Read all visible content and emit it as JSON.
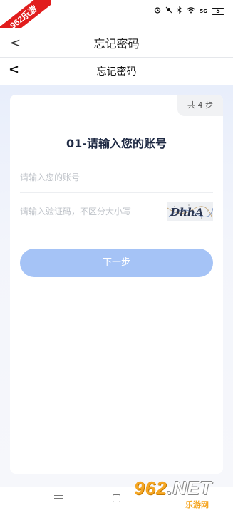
{
  "status_bar": {
    "signal_label": "5G",
    "battery_label": "5"
  },
  "watermark": {
    "ribbon": "962乐游",
    "logo_number": "962",
    "logo_suffix": ".NET",
    "logo_sub": "乐游网"
  },
  "outer_header": {
    "back_glyph": "<",
    "title": "忘记密码"
  },
  "inner_header": {
    "back_glyph": "<",
    "title": "忘记密码"
  },
  "card": {
    "step_badge": "共 4 步",
    "step_title": "01-请输入您的账号",
    "account_field": {
      "value": "",
      "placeholder": "请输入您的账号"
    },
    "captcha_field": {
      "value": "",
      "placeholder": "请输入验证码，不区分大小写",
      "captcha_text": "DhhA"
    },
    "next_button": "下一步"
  },
  "nav_bar": {
    "items": [
      "menu-icon",
      "home-icon"
    ]
  },
  "colors": {
    "accent": "#a5c3f6",
    "title_text": "#1f2a44",
    "watermark_orange": "#f5a623",
    "watermark_red": "#e11d1d"
  }
}
